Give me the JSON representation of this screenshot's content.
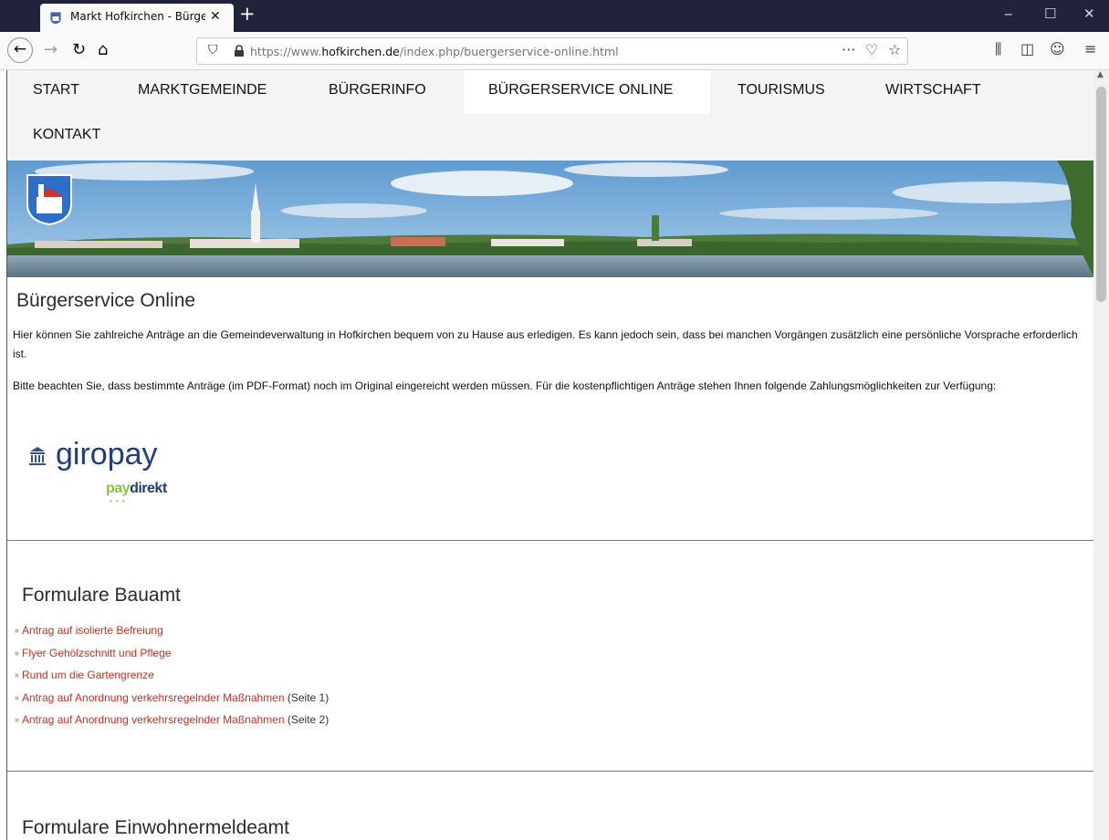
{
  "browser": {
    "tab_title": "Markt Hofkirchen - Bürgerservice",
    "tab_close": "✕",
    "new_tab": "+",
    "url_prefix": "https://www.",
    "url_domain": "hofkirchen.de",
    "url_path": "/index.php/buergerservice-online.html",
    "icons": [
      "back-icon",
      "forward-icon",
      "reload-icon",
      "home-icon",
      "shield-icon",
      "lock-icon",
      "more-icon",
      "pocket-icon",
      "star-icon",
      "library-icon",
      "sidebar-icon",
      "account-icon",
      "menu-icon",
      "minimize-icon",
      "maximize-icon",
      "close-icon"
    ]
  },
  "nav": {
    "items": [
      "START",
      "MARKTGEMEINDE",
      "BÜRGERINFO",
      "BÜRGERSERVICE ONLINE",
      "TOURISMUS",
      "WIRTSCHAFT",
      "KONTAKT"
    ],
    "active": "BÜRGERSERVICE ONLINE"
  },
  "main": {
    "title": "Bürgerservice Online",
    "intro": "Hier können Sie zahlreiche Anträge an die Gemeindeverwaltung in Hofkirchen bequem von zu Hause aus erledigen. Es kann jedoch sein, dass bei manchen Vorgängen zusätzlich eine persönliche Vorsprache erforderlich ist.",
    "payment_note": "Bitte beachten Sie, dass bestimmte Anträge (im PDF-Format) noch im Original eingereicht werden müssen. Für die kostenpflichtigen Anträge stehen Ihnen folgende Zahlungsmöglichkeiten zur Verfügung:",
    "logo_giropay": "giropay",
    "logo_paydirekt_pay": "pay",
    "logo_paydirekt_direkt": "direkt"
  },
  "sections": [
    {
      "title": "Formulare Bauamt",
      "links": [
        {
          "label": "Antrag auf isolierte Befreiung",
          "suffix": ""
        },
        {
          "label": "Flyer Gehölzschnitt und Pflege",
          "suffix": ""
        },
        {
          "label": "Rund um die Gartengrenze",
          "suffix": ""
        },
        {
          "label": "Antrag auf Anordnung verkehrsregelnder Maßnahmen",
          "suffix": " (Seite 1)"
        },
        {
          "label": "Antrag auf Anordnung verkehrsregelnder Maßnahmen",
          "suffix": " (Seite 2)"
        }
      ]
    },
    {
      "title": "Formulare Einwohnermeldeamt",
      "links": []
    }
  ],
  "colors": {
    "link": "#d42a1f",
    "menu_bg": "#f4f4f4",
    "tabbar_bg": "#20233a",
    "giropay_blue": "#1f3e7c",
    "paydirekt_blue": "#1f3e7c",
    "paydirekt_green": "#8ac23b"
  }
}
